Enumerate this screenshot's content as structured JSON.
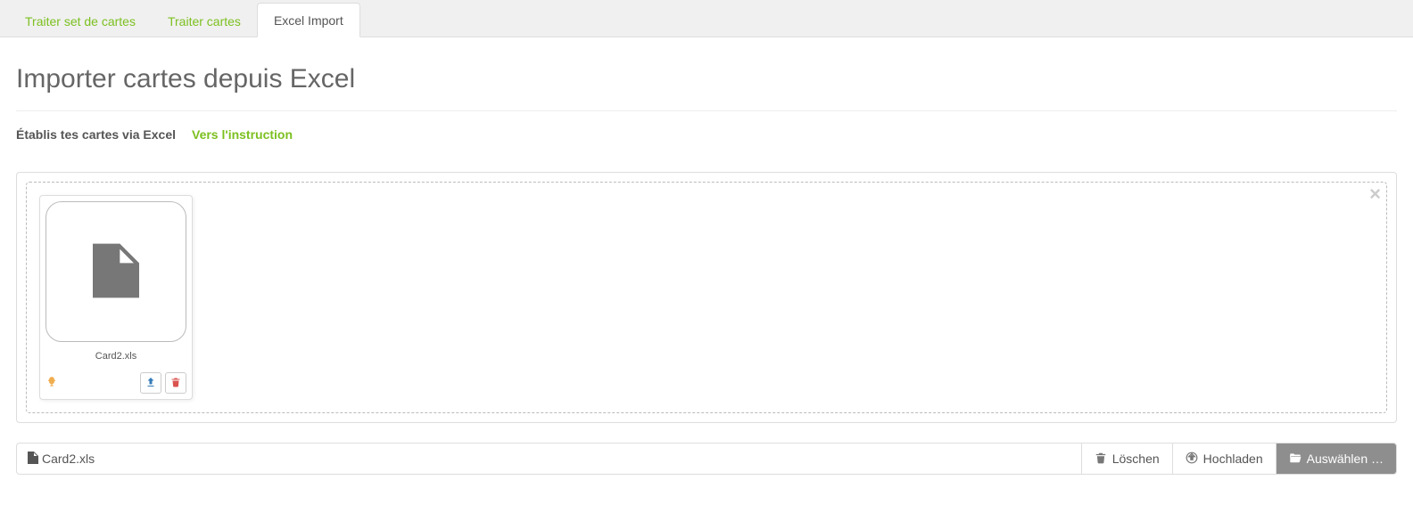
{
  "tabs": [
    {
      "label": "Traiter set de cartes",
      "active": false
    },
    {
      "label": "Traiter cartes",
      "active": false
    },
    {
      "label": "Excel Import",
      "active": true
    }
  ],
  "page_title": "Importer cartes depuis Excel",
  "subtitle": "Établis tes cartes via Excel",
  "instruction_link": "Vers l'instruction",
  "file": {
    "name": "Card2.xls"
  },
  "selected_file_name": "Card2.xls",
  "buttons": {
    "delete": "Löschen",
    "upload": "Hochladen",
    "select": "Auswählen …"
  }
}
